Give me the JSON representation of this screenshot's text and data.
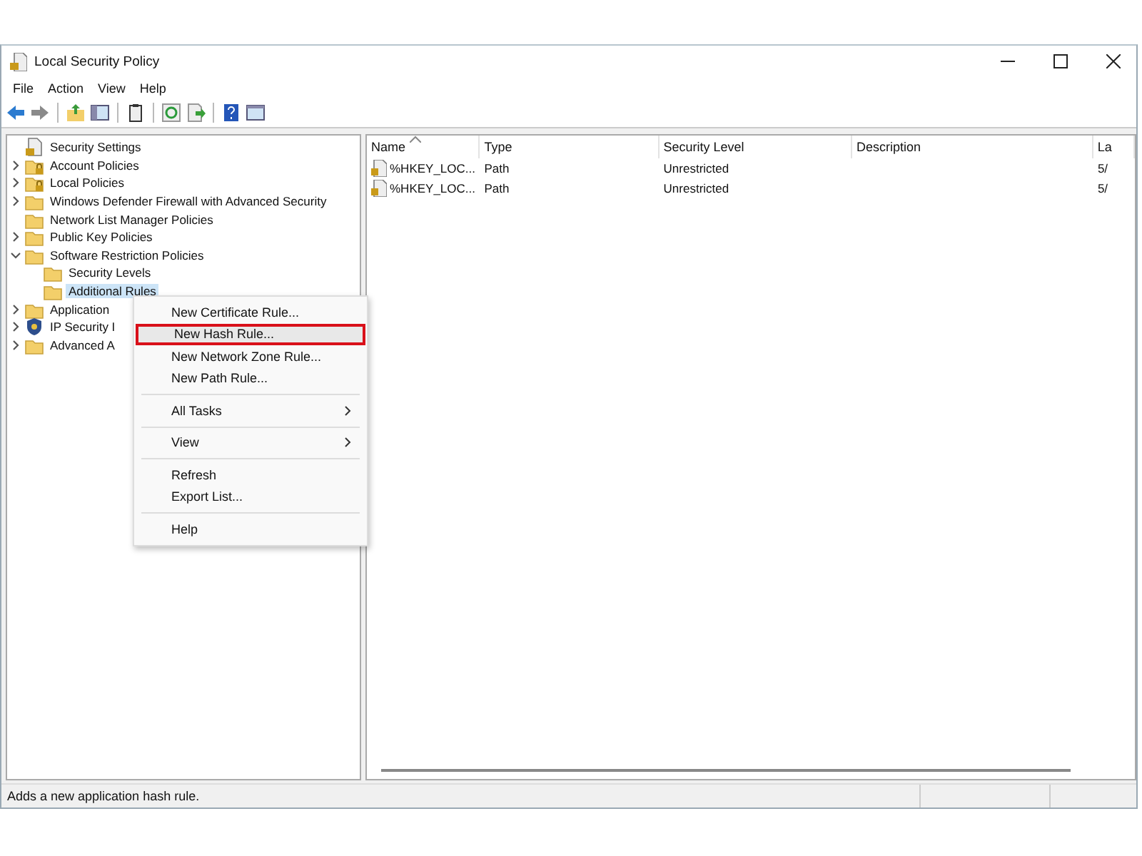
{
  "window": {
    "title": "Local Security Policy"
  },
  "menu_bar": [
    "File",
    "Action",
    "View",
    "Help"
  ],
  "tree": {
    "items": [
      {
        "label": "Security Settings",
        "selected": false,
        "children": [
          {
            "label": "Account Policies",
            "expanded": false,
            "selected": false
          },
          {
            "label": "Local Policies",
            "expanded": false,
            "selected": false
          },
          {
            "label": "Windows Defender Firewall with Advanced Security",
            "expanded": false,
            "selected": false
          },
          {
            "label": "Network List Manager Policies",
            "selected": false
          },
          {
            "label": "Public Key Policies",
            "expanded": false,
            "selected": false
          },
          {
            "label": "Software Restriction Policies",
            "expanded": true,
            "selected": false,
            "children": [
              {
                "label": "Security Levels",
                "selected": false
              },
              {
                "label": "Additional Rules",
                "selected": true
              }
            ]
          },
          {
            "label": "Application",
            "expanded": false,
            "selected": false
          },
          {
            "label": "IP Security I",
            "expanded": false,
            "selected": false
          },
          {
            "label": "Advanced A",
            "expanded": false,
            "selected": false
          }
        ]
      }
    ]
  },
  "context_menu": [
    {
      "kind": "item",
      "label": "New Certificate Rule...",
      "selected": false
    },
    {
      "kind": "item",
      "label": "New Hash Rule...",
      "selected": true
    },
    {
      "kind": "item",
      "label": "New Network Zone Rule...",
      "selected": false
    },
    {
      "kind": "item",
      "label": "New Path Rule...",
      "selected": false
    },
    {
      "kind": "separator"
    },
    {
      "kind": "submenu",
      "label": "All Tasks",
      "selected": false
    },
    {
      "kind": "separator"
    },
    {
      "kind": "submenu",
      "label": "View",
      "selected": false
    },
    {
      "kind": "separator"
    },
    {
      "kind": "item",
      "label": "Refresh",
      "selected": false
    },
    {
      "kind": "item",
      "label": "Export List...",
      "selected": false
    },
    {
      "kind": "separator"
    },
    {
      "kind": "item",
      "label": "Help",
      "selected": false
    }
  ],
  "table": {
    "columns": [
      "Name",
      "Type",
      "Security Level",
      "Description",
      "La"
    ],
    "rows": [
      [
        "%HKEY_LOC...",
        "Path",
        "Unrestricted",
        "",
        "5/"
      ],
      [
        "%HKEY_LOC...",
        "Path",
        "Unrestricted",
        "",
        "5/"
      ]
    ]
  },
  "status_bar": "Adds a new application hash rule."
}
